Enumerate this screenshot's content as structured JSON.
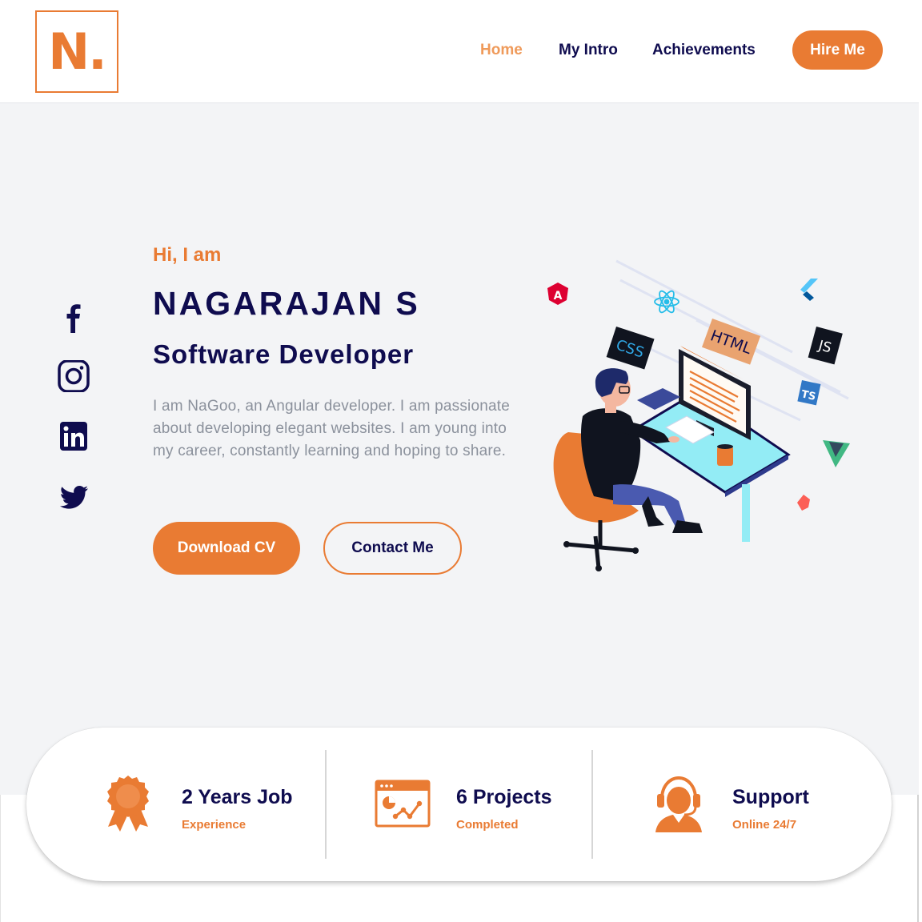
{
  "header": {
    "logo_text": "N.",
    "nav": [
      "Home",
      "My Intro",
      "Achievements"
    ],
    "hire_label": "Hire Me"
  },
  "hero": {
    "greeting": "Hi, I am",
    "name": "NAGARAJAN S",
    "role": "Software Developer",
    "description": "I am NaGoo, an Angular developer. I am passionate about developing elegant websites. I am young into my career, constantly learning and hoping to share.",
    "primary_button": "Download CV",
    "secondary_button": "Contact Me"
  },
  "social": [
    "facebook-icon",
    "instagram-icon",
    "linkedin-icon",
    "twitter-icon"
  ],
  "illustration": {
    "tags": [
      "CSS",
      "HTML",
      "JS",
      "TS",
      "A"
    ]
  },
  "stats": [
    {
      "icon": "award-ribbon-icon",
      "title": "2 Years Job",
      "subtitle": "Experience"
    },
    {
      "icon": "analytics-window-icon",
      "title": "6 Projects",
      "subtitle": "Completed"
    },
    {
      "icon": "headset-support-icon",
      "title": "Support",
      "subtitle": "Online 24/7"
    }
  ],
  "colors": {
    "accent": "#e97b33",
    "navy": "#0f0c4f",
    "hero_bg": "#f3f4f6",
    "muted_text": "#8b919c"
  }
}
